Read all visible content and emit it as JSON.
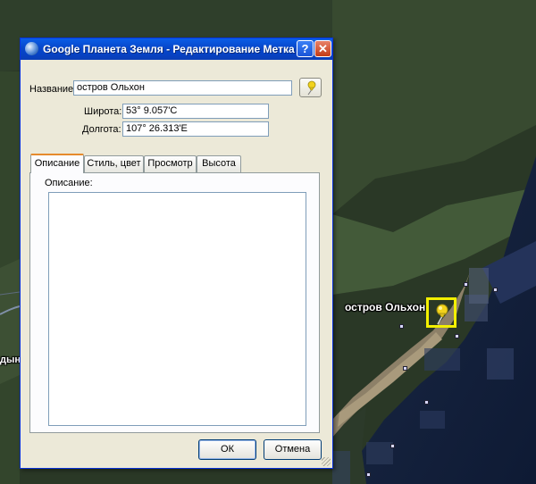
{
  "map": {
    "place_label": "остров Ольхон",
    "edge_label": "дын"
  },
  "dialog": {
    "title": "Google Планета Земля - Редактирование Метка",
    "help_glyph": "?",
    "close_glyph": "✕",
    "name_label": "Название:",
    "name_value": "остров Ольхон",
    "lat_label": "Широта:",
    "lat_value": "53° 9.057'С",
    "lon_label": "Долгота:",
    "lon_value": "107° 26.313'E",
    "tabs": [
      {
        "label": "Описание"
      },
      {
        "label": "Стиль, цвет"
      },
      {
        "label": "Просмотр"
      },
      {
        "label": "Высота"
      }
    ],
    "description_label": "Описание:",
    "description_value": "",
    "ok_label": "ОК",
    "cancel_label": "Отмена"
  },
  "colors": {
    "titlebar": "#0a5ee8",
    "dialog_bg": "#ece9d8",
    "pin_box": "#f3f000",
    "pin": "#f2d21c"
  },
  "icons": {
    "app": "google-earth-icon",
    "pin_button": "pushpin-icon",
    "map_marker": "pushpin-icon"
  }
}
